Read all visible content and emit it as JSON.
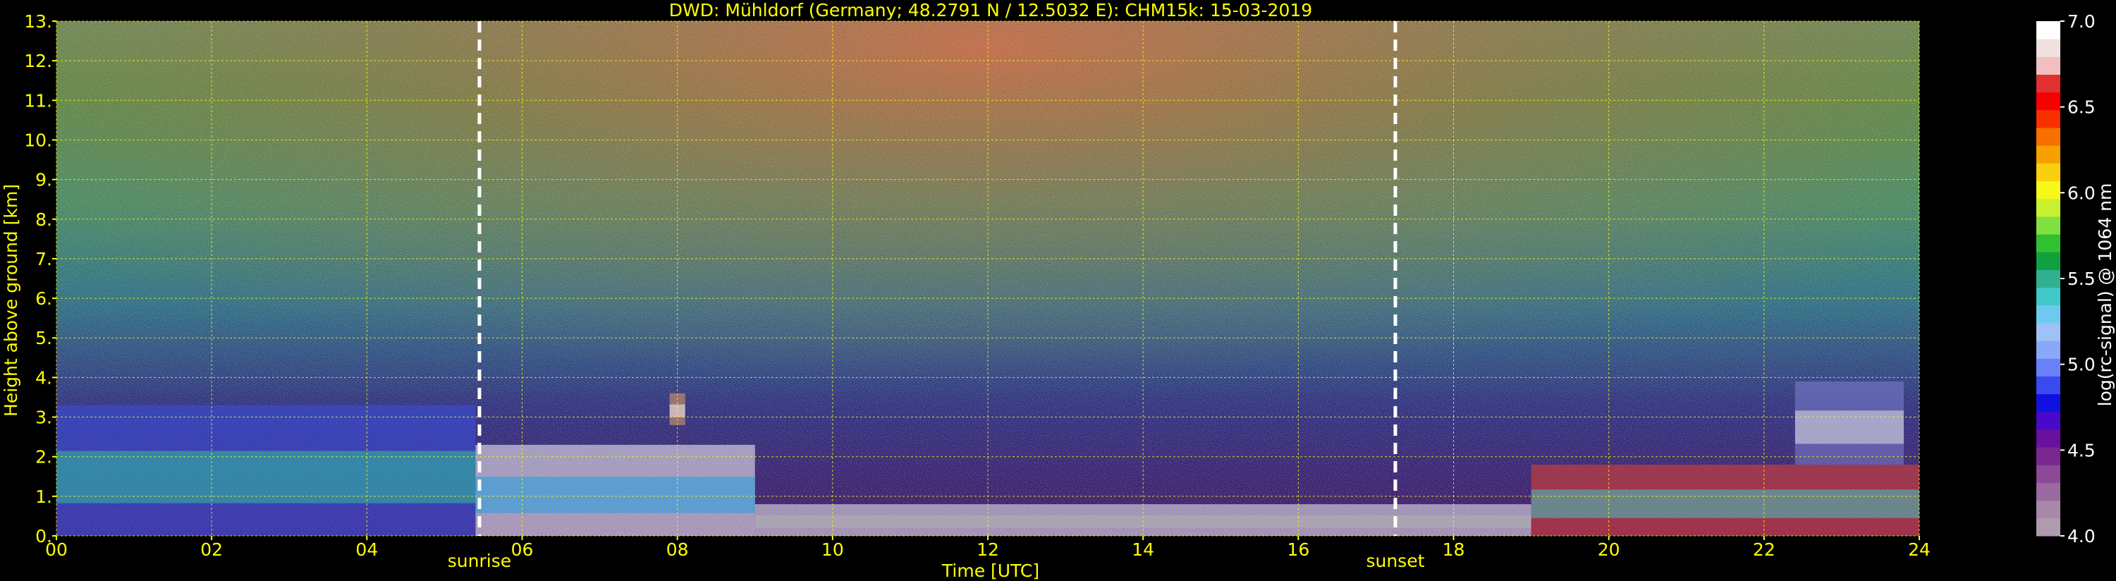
{
  "chart_data": {
    "type": "heatmap",
    "title": "DWD: Mühldorf (Germany; 48.2791 N / 12.5032 E):    CHM15k: 15-03-2019",
    "xlabel": "Time [UTC]",
    "ylabel": "Height above ground [km]",
    "xlim": [
      0,
      24
    ],
    "ylim": [
      0,
      13
    ],
    "x_ticks": [
      0,
      2,
      4,
      6,
      8,
      10,
      12,
      14,
      16,
      18,
      20,
      22,
      24
    ],
    "x_tick_labels": [
      "00",
      "02",
      "04",
      "06",
      "08",
      "10",
      "12",
      "14",
      "16",
      "18",
      "20",
      "22",
      "24"
    ],
    "y_ticks": [
      0,
      1,
      2,
      3,
      4,
      5,
      6,
      7,
      8,
      9,
      10,
      11,
      12,
      13
    ],
    "y_tick_labels": [
      "0.",
      "1.",
      "2.",
      "3.",
      "4.",
      "5.",
      "6.",
      "7.",
      "8.",
      "9.",
      "10.",
      "11.",
      "12.",
      "13."
    ],
    "grid": true,
    "grid_color": "#ffff00",
    "annotations": [
      {
        "text": "sunrise",
        "x": 5.45
      },
      {
        "text": "sunset",
        "x": 17.25
      }
    ],
    "colorbar": {
      "label": "log(rc-signal) @ 1064 nm",
      "range": [
        4.0,
        7.0
      ],
      "tick_values": [
        4.0,
        4.5,
        5.0,
        5.5,
        6.0,
        6.5,
        7.0
      ],
      "tick_labels": [
        "4.0",
        "4.5",
        "5.0",
        "5.5",
        "6.0",
        "6.5",
        "7.0"
      ],
      "colors": [
        "#b09ab0",
        "#a888a8",
        "#9a6aa0",
        "#8a4a98",
        "#7a2890",
        "#6a10a0",
        "#4a08c8",
        "#1010e0",
        "#3a4af0",
        "#6a80f8",
        "#8aa8f8",
        "#a0c0f8",
        "#70c8f0",
        "#40c8c8",
        "#30b090",
        "#10a040",
        "#30c030",
        "#80e040",
        "#c8f030",
        "#f8f818",
        "#f8d010",
        "#f8a000",
        "#f87000",
        "#f83000",
        "#f80000",
        "#e03030",
        "#f0c0c0",
        "#f0e0e0",
        "#ffffff"
      ]
    },
    "features": [
      {
        "kind": "boundary-layer aerosol",
        "x_range": [
          0.0,
          5.4
        ],
        "height_range": [
          0.0,
          3.3
        ]
      },
      {
        "kind": "cloud/aerosol layer",
        "x_range": [
          5.4,
          9.0
        ],
        "height_range": [
          0.0,
          2.3
        ]
      },
      {
        "kind": "isolated cloud",
        "x_range": [
          7.9,
          8.1
        ],
        "height_range": [
          2.8,
          3.6
        ]
      },
      {
        "kind": "near-surface signal",
        "x_range": [
          9.0,
          19.0
        ],
        "height_range": [
          0.0,
          0.8
        ]
      },
      {
        "kind": "boundary-layer aerosol",
        "x_range": [
          19.0,
          24.0
        ],
        "height_range": [
          0.0,
          1.8
        ]
      },
      {
        "kind": "elevated features",
        "x_range": [
          22.4,
          23.8
        ],
        "height_range": [
          1.8,
          3.9
        ]
      }
    ]
  }
}
